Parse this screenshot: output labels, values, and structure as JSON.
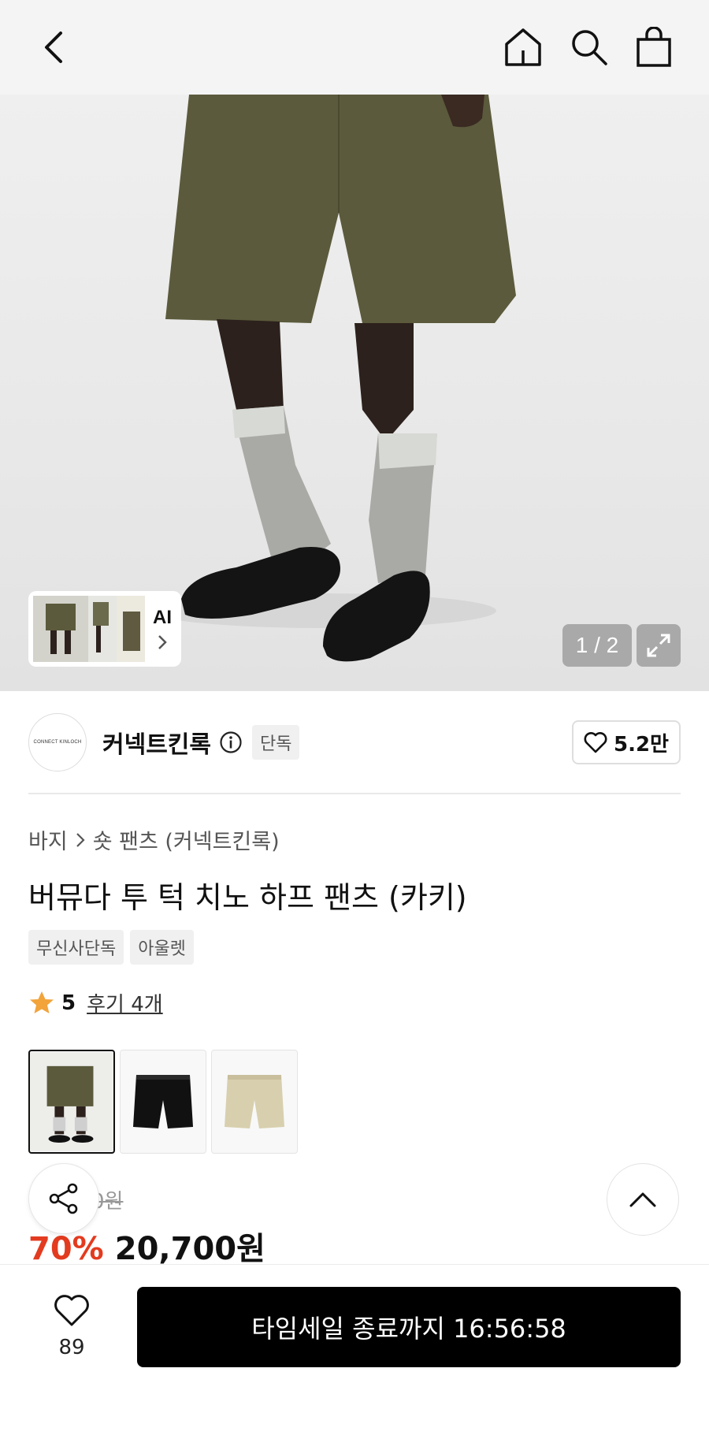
{
  "header": {
    "back_icon": "chevron-left-icon",
    "home_icon": "home-icon",
    "search_icon": "search-icon",
    "cart_icon": "shopping-bag-icon"
  },
  "gallery": {
    "ai_label": "AI",
    "counter": "1 / 2",
    "expand_icon": "expand-icon"
  },
  "brand": {
    "logo_text": "CONNECT KINLOCH",
    "name": "커넥트킨록",
    "exclusive_tag": "단독",
    "like_count": "5.2만"
  },
  "product": {
    "breadcrumb": [
      "바지",
      "숏 팬츠 (커넥트킨록)"
    ],
    "title": "버뮤다 투 턱 치노 하프 팬츠 (카키)",
    "tags": [
      "무신사단독",
      "아울렛"
    ],
    "rating": "5",
    "reviews": "후기 4개"
  },
  "colors": [
    {
      "name": "khaki",
      "hex": "#5b5a3c"
    },
    {
      "name": "black",
      "hex": "#111111"
    },
    {
      "name": "beige",
      "hex": "#d8cfae"
    }
  ],
  "price": {
    "original": "0원",
    "discount": "70%",
    "sale": "20,700원"
  },
  "bottom": {
    "wish_count": "89",
    "buy_label": "타임세일 종료까지 16:56:58"
  },
  "theme": {
    "accent_red": "#e33b1f",
    "star": "#f2a33a"
  }
}
